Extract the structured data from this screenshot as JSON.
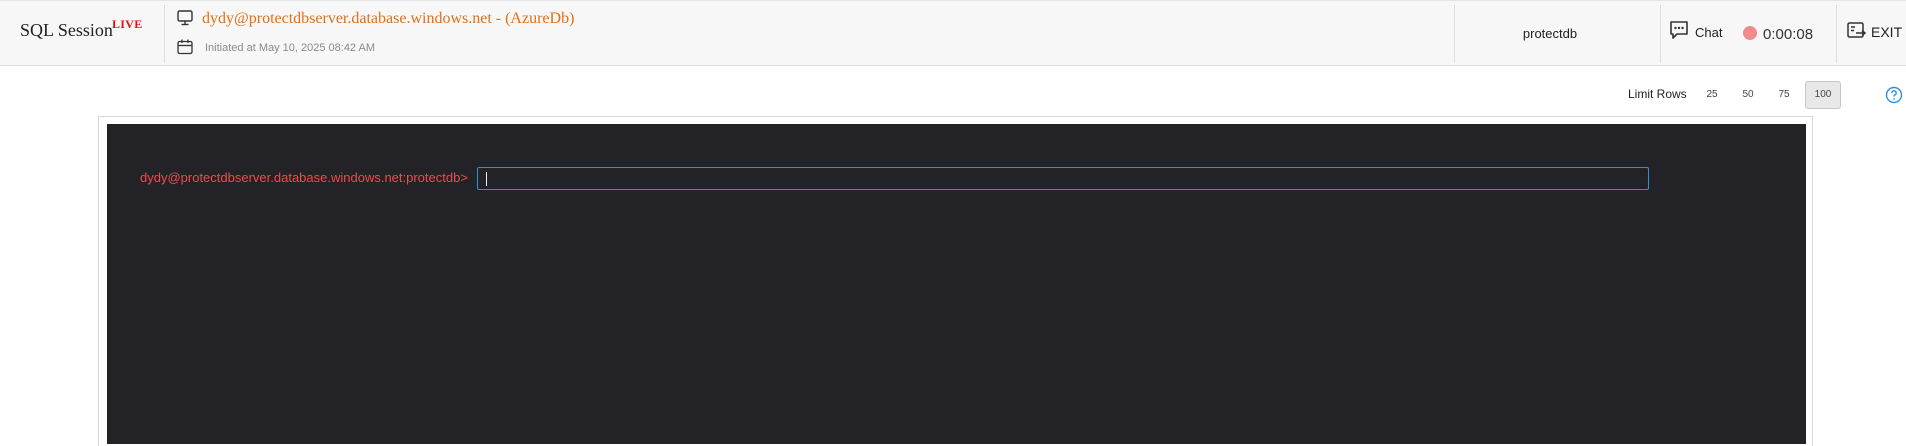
{
  "header": {
    "session_title": "SQL Session",
    "live_badge": "LIVE",
    "connection": "dydy@protectdbserver.database.windows.net - (AzureDb)",
    "initiated": "Initiated at May 10, 2025 08:42 AM",
    "database": "protectdb",
    "chat_label": "Chat",
    "timer": "0:00:08",
    "exit_label": "EXIT",
    "icons": {
      "connection": "monitor-icon",
      "initiated": "calendar-icon",
      "chat": "chat-bubble-icon",
      "recording": "record-dot-icon",
      "exit": "exit-icon",
      "help": "help-icon"
    }
  },
  "limit_rows": {
    "label": "Limit Rows",
    "options": [
      "25",
      "50",
      "75",
      "100"
    ],
    "selected": "100"
  },
  "terminal": {
    "prompt": "dydy@protectdbserver.database.windows.net:protectdb>",
    "input_value": ""
  },
  "colors": {
    "accent_orange": "#e0701a",
    "live_red": "#e01010",
    "prompt_red": "#f04a4a",
    "terminal_bg": "#232227",
    "input_border": "#2f8fd8",
    "record_dot": "#f28b8b"
  }
}
